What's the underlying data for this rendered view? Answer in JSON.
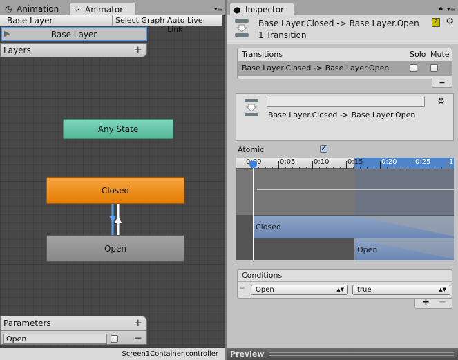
{
  "left_panel": {
    "tabs": [
      {
        "label": "Animation",
        "icon": "clock-icon"
      },
      {
        "label": "Animator",
        "icon": "animator-icon"
      }
    ],
    "breadcrumb": "Base Layer",
    "toolbar": {
      "select_graph": "Select Graph",
      "auto_live_link": "Auto Live Link"
    },
    "layer_item": "Base Layer",
    "layers_title": "Layers",
    "nodes": {
      "any_state": "Any State",
      "closed": "Closed",
      "open": "Open"
    },
    "parameters": {
      "title": "Parameters",
      "items": [
        {
          "name": "Open",
          "value": false
        }
      ]
    },
    "status": "Screen1Container.controller",
    "colors": {
      "any_state": "#62c4a6",
      "closed": "#f08a0c",
      "open": "#8f8f8f",
      "accent": "#3d82e0"
    }
  },
  "inspector": {
    "tab": "Inspector",
    "header": {
      "title": "Base Layer.Closed -> Base Layer.Open",
      "subtitle": "1 Transition"
    },
    "transitions": {
      "header": "Transitions",
      "solo": "Solo",
      "mute": "Mute",
      "rows": [
        {
          "name": "Base Layer.Closed -> Base Layer.Open",
          "solo": false,
          "mute": false
        }
      ]
    },
    "detail": {
      "name_value": "",
      "title": "Base Layer.Closed -> Base Layer.Open"
    },
    "atomic": {
      "label": "Atomic",
      "checked": true
    },
    "timeline": {
      "ticks": [
        "0:00",
        "0:05",
        "0:10",
        "0:15",
        "0:20",
        "0:25",
        "1"
      ],
      "clips": {
        "from": "Closed",
        "to": "Open"
      }
    },
    "conditions": {
      "title": "Conditions",
      "rows": [
        {
          "parameter": "Open",
          "value": "true"
        }
      ]
    },
    "preview": "Preview"
  }
}
